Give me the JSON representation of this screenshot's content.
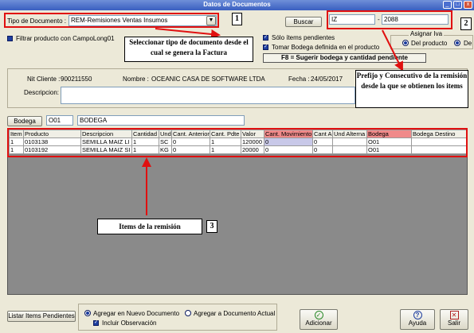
{
  "window": {
    "title": "Datos de Documentos",
    "min": "_",
    "max": "□",
    "close": "x"
  },
  "top": {
    "tipo_label": "Tipo de Documento :",
    "tipo_value": "REM-Remisiones Ventas Insumos",
    "buscar_label": "Buscar",
    "prefijo": "IZ",
    "consecutivo": "2088",
    "filtrar_label": "Filtrar producto con CampoLong01",
    "solo_label": "Sólo ítems pendientes",
    "tomar_label": "Tomar Bodega definida en el producto",
    "asignar_label": "Asignar Iva",
    "del_producto": "Del producto",
    "de_label": "De",
    "f8_label": "F8 = Sugerir bodega y cantidad pendiente"
  },
  "client": {
    "nit_label": "Nit Cliente :",
    "nit_value": "900211550",
    "nombre_label": "Nombre :",
    "nombre_value": "OCEANIC CASA DE SOFTWARE LTDA",
    "fecha_label": "Fecha :",
    "fecha_value": "24/05/2017",
    "descripcion_label": "Descripcion:"
  },
  "bodega": {
    "button": "Bodega",
    "code": "O01",
    "name": "BODEGA"
  },
  "table": {
    "headers": [
      "Item",
      "Producto",
      "Descripcion",
      "Cantidad",
      "Und",
      "Cant. Anterior",
      "Cant. Pdte",
      "Valor",
      "Cant. Movimiento",
      "Cant A",
      "Und Alterna",
      "Bodega",
      "Bodega Destino"
    ],
    "rows": [
      [
        "1",
        "0103138",
        "SEMILLA MAIZ LI",
        "1",
        "SC",
        "0",
        "1",
        "120000",
        "0",
        "0",
        "",
        "O01",
        ""
      ],
      [
        "1",
        "0103192",
        "SEMILLA MAIZ SI",
        "1",
        "KG",
        "0",
        "1",
        "20000",
        "0",
        "0",
        "",
        "O01",
        ""
      ]
    ]
  },
  "callouts": {
    "c1": "Seleccionar tipo de documento desde el cual se genera la Factura",
    "c2": "Prefijo y Consecutivo de la remisión desde la que se obtienen los items",
    "c3": "Items de la remisión",
    "n1": "1",
    "n2": "2",
    "n3": "3"
  },
  "bottom": {
    "listar": "Listar Items Pendientes",
    "agregar_nuevo": "Agregar en Nuevo Documento",
    "agregar_actual": "Agregar a Documento Actual",
    "incluir": "Incluir Observación",
    "adicionar": "Adicionar",
    "ayuda": "Ayuda",
    "salir": "Salir"
  },
  "colors": {
    "accent_red": "#e01010",
    "grid_bg": "#8a8a8a",
    "header_highlight": "#f08a8a"
  }
}
